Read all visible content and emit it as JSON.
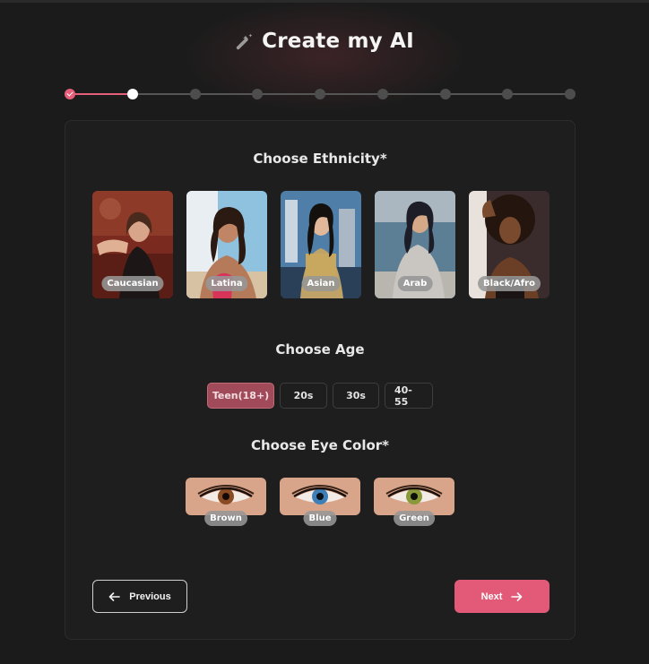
{
  "header": {
    "title": "Create my AI",
    "icon": "magic-wand-icon"
  },
  "stepper": {
    "total_steps": 9,
    "current_step": 2,
    "completed_steps": 1,
    "accent": "#e65f79"
  },
  "ethnicity": {
    "title": "Choose Ethnicity*",
    "options": [
      {
        "label": "Caucasian"
      },
      {
        "label": "Latina"
      },
      {
        "label": "Asian"
      },
      {
        "label": "Arab"
      },
      {
        "label": "Black/Afro"
      }
    ]
  },
  "age": {
    "title": "Choose Age",
    "options": [
      {
        "label": "Teen(18+)",
        "selected": true
      },
      {
        "label": "20s",
        "selected": false
      },
      {
        "label": "30s",
        "selected": false
      },
      {
        "label": "40-55",
        "selected": false
      }
    ]
  },
  "eye_color": {
    "title": "Choose Eye Color*",
    "options": [
      {
        "label": "Brown",
        "iris": "#8a4a22"
      },
      {
        "label": "Blue",
        "iris": "#3f7fb8"
      },
      {
        "label": "Green",
        "iris": "#8a9a3a"
      }
    ]
  },
  "nav": {
    "previous_label": "Previous",
    "next_label": "Next"
  },
  "colors": {
    "accent": "#e25a77",
    "selected_age": "#a14b5a",
    "background": "#1b1b1b"
  }
}
